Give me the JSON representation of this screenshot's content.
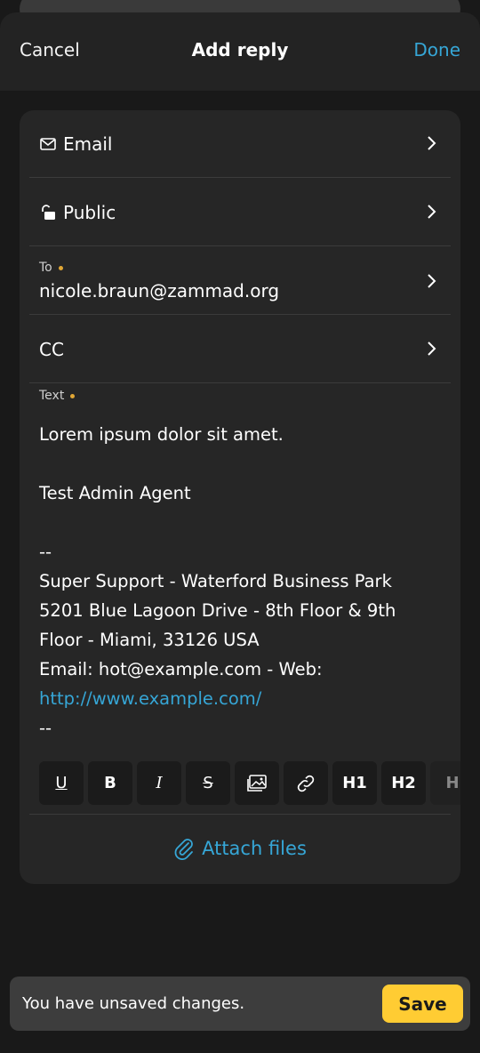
{
  "header": {
    "cancel": "Cancel",
    "title": "Add reply",
    "done": "Done"
  },
  "rows": {
    "type": {
      "label": "Email",
      "icon": "mail-icon"
    },
    "visibility": {
      "label": "Public",
      "icon": "unlock-icon"
    },
    "to": {
      "label": "To",
      "value": "nicole.braun@zammad.org"
    },
    "cc": {
      "label": "CC"
    }
  },
  "text": {
    "label": "Text",
    "lines": [
      "Lorem ipsum dolor sit amet.",
      "",
      "Test Admin Agent",
      "",
      "--",
      "Super Support - Waterford Business Park",
      "5201 Blue Lagoon Drive - 8th Floor & 9th",
      "Floor - Miami, 33126 USA",
      "Email: hot@example.com - Web:",
      "http://www.example.com/",
      "--"
    ]
  },
  "toolbar": {
    "buttons": [
      {
        "name": "underline-button",
        "glyph": "U"
      },
      {
        "name": "bold-button",
        "glyph": "B"
      },
      {
        "name": "italic-button",
        "glyph": "I"
      },
      {
        "name": "strikethrough-button",
        "glyph": "S"
      },
      {
        "name": "image-button",
        "glyph": "image"
      },
      {
        "name": "link-button",
        "glyph": "link"
      },
      {
        "name": "heading1-button",
        "glyph": "H1"
      },
      {
        "name": "heading2-button",
        "glyph": "H2"
      },
      {
        "name": "heading3-button",
        "glyph": "H"
      }
    ]
  },
  "attach": {
    "label": "Attach files",
    "icon": "paperclip-icon"
  },
  "bottom": {
    "message": "You have unsaved changes.",
    "save": "Save"
  },
  "colors": {
    "accent": "#36a6d6",
    "required_dot": "#e1a735",
    "save_button": "#ffcc33"
  }
}
